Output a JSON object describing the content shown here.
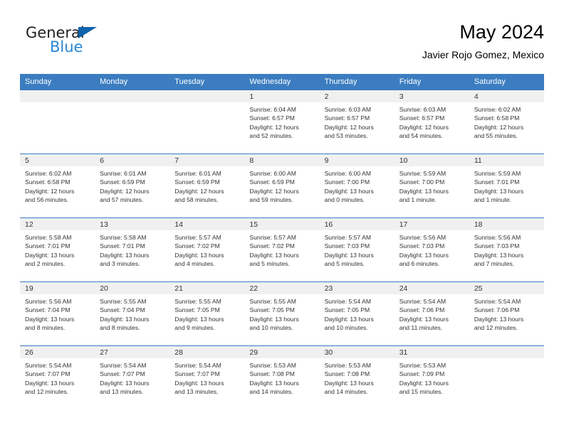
{
  "brand": {
    "general": "General",
    "blue": "Blue",
    "triangle_color": "#0d63ac",
    "blue_color": "#2787d6"
  },
  "header": {
    "title": "May 2024",
    "subtitle": "Javier Rojo Gomez, Mexico"
  },
  "theme": {
    "header_bg": "#3b7dc0",
    "day_band_bg": "#f0f0f0",
    "row_rule": "#3b7dc0",
    "text": "#333333"
  },
  "weekday_headers": [
    "Sunday",
    "Monday",
    "Tuesday",
    "Wednesday",
    "Thursday",
    "Friday",
    "Saturday"
  ],
  "weeks": [
    [
      {
        "day": "",
        "lines": []
      },
      {
        "day": "",
        "lines": []
      },
      {
        "day": "",
        "lines": []
      },
      {
        "day": "1",
        "lines": [
          "Sunrise: 6:04 AM",
          "Sunset: 6:57 PM",
          "Daylight: 12 hours",
          "and 52 minutes."
        ]
      },
      {
        "day": "2",
        "lines": [
          "Sunrise: 6:03 AM",
          "Sunset: 6:57 PM",
          "Daylight: 12 hours",
          "and 53 minutes."
        ]
      },
      {
        "day": "3",
        "lines": [
          "Sunrise: 6:03 AM",
          "Sunset: 6:57 PM",
          "Daylight: 12 hours",
          "and 54 minutes."
        ]
      },
      {
        "day": "4",
        "lines": [
          "Sunrise: 6:02 AM",
          "Sunset: 6:58 PM",
          "Daylight: 12 hours",
          "and 55 minutes."
        ]
      }
    ],
    [
      {
        "day": "5",
        "lines": [
          "Sunrise: 6:02 AM",
          "Sunset: 6:58 PM",
          "Daylight: 12 hours",
          "and 56 minutes."
        ]
      },
      {
        "day": "6",
        "lines": [
          "Sunrise: 6:01 AM",
          "Sunset: 6:59 PM",
          "Daylight: 12 hours",
          "and 57 minutes."
        ]
      },
      {
        "day": "7",
        "lines": [
          "Sunrise: 6:01 AM",
          "Sunset: 6:59 PM",
          "Daylight: 12 hours",
          "and 58 minutes."
        ]
      },
      {
        "day": "8",
        "lines": [
          "Sunrise: 6:00 AM",
          "Sunset: 6:59 PM",
          "Daylight: 12 hours",
          "and 59 minutes."
        ]
      },
      {
        "day": "9",
        "lines": [
          "Sunrise: 6:00 AM",
          "Sunset: 7:00 PM",
          "Daylight: 13 hours",
          "and 0 minutes."
        ]
      },
      {
        "day": "10",
        "lines": [
          "Sunrise: 5:59 AM",
          "Sunset: 7:00 PM",
          "Daylight: 13 hours",
          "and 1 minute."
        ]
      },
      {
        "day": "11",
        "lines": [
          "Sunrise: 5:59 AM",
          "Sunset: 7:01 PM",
          "Daylight: 13 hours",
          "and 1 minute."
        ]
      }
    ],
    [
      {
        "day": "12",
        "lines": [
          "Sunrise: 5:58 AM",
          "Sunset: 7:01 PM",
          "Daylight: 13 hours",
          "and 2 minutes."
        ]
      },
      {
        "day": "13",
        "lines": [
          "Sunrise: 5:58 AM",
          "Sunset: 7:01 PM",
          "Daylight: 13 hours",
          "and 3 minutes."
        ]
      },
      {
        "day": "14",
        "lines": [
          "Sunrise: 5:57 AM",
          "Sunset: 7:02 PM",
          "Daylight: 13 hours",
          "and 4 minutes."
        ]
      },
      {
        "day": "15",
        "lines": [
          "Sunrise: 5:57 AM",
          "Sunset: 7:02 PM",
          "Daylight: 13 hours",
          "and 5 minutes."
        ]
      },
      {
        "day": "16",
        "lines": [
          "Sunrise: 5:57 AM",
          "Sunset: 7:03 PM",
          "Daylight: 13 hours",
          "and 5 minutes."
        ]
      },
      {
        "day": "17",
        "lines": [
          "Sunrise: 5:56 AM",
          "Sunset: 7:03 PM",
          "Daylight: 13 hours",
          "and 6 minutes."
        ]
      },
      {
        "day": "18",
        "lines": [
          "Sunrise: 5:56 AM",
          "Sunset: 7:03 PM",
          "Daylight: 13 hours",
          "and 7 minutes."
        ]
      }
    ],
    [
      {
        "day": "19",
        "lines": [
          "Sunrise: 5:56 AM",
          "Sunset: 7:04 PM",
          "Daylight: 13 hours",
          "and 8 minutes."
        ]
      },
      {
        "day": "20",
        "lines": [
          "Sunrise: 5:55 AM",
          "Sunset: 7:04 PM",
          "Daylight: 13 hours",
          "and 8 minutes."
        ]
      },
      {
        "day": "21",
        "lines": [
          "Sunrise: 5:55 AM",
          "Sunset: 7:05 PM",
          "Daylight: 13 hours",
          "and 9 minutes."
        ]
      },
      {
        "day": "22",
        "lines": [
          "Sunrise: 5:55 AM",
          "Sunset: 7:05 PM",
          "Daylight: 13 hours",
          "and 10 minutes."
        ]
      },
      {
        "day": "23",
        "lines": [
          "Sunrise: 5:54 AM",
          "Sunset: 7:05 PM",
          "Daylight: 13 hours",
          "and 10 minutes."
        ]
      },
      {
        "day": "24",
        "lines": [
          "Sunrise: 5:54 AM",
          "Sunset: 7:06 PM",
          "Daylight: 13 hours",
          "and 11 minutes."
        ]
      },
      {
        "day": "25",
        "lines": [
          "Sunrise: 5:54 AM",
          "Sunset: 7:06 PM",
          "Daylight: 13 hours",
          "and 12 minutes."
        ]
      }
    ],
    [
      {
        "day": "26",
        "lines": [
          "Sunrise: 5:54 AM",
          "Sunset: 7:07 PM",
          "Daylight: 13 hours",
          "and 12 minutes."
        ]
      },
      {
        "day": "27",
        "lines": [
          "Sunrise: 5:54 AM",
          "Sunset: 7:07 PM",
          "Daylight: 13 hours",
          "and 13 minutes."
        ]
      },
      {
        "day": "28",
        "lines": [
          "Sunrise: 5:54 AM",
          "Sunset: 7:07 PM",
          "Daylight: 13 hours",
          "and 13 minutes."
        ]
      },
      {
        "day": "29",
        "lines": [
          "Sunrise: 5:53 AM",
          "Sunset: 7:08 PM",
          "Daylight: 13 hours",
          "and 14 minutes."
        ]
      },
      {
        "day": "30",
        "lines": [
          "Sunrise: 5:53 AM",
          "Sunset: 7:08 PM",
          "Daylight: 13 hours",
          "and 14 minutes."
        ]
      },
      {
        "day": "31",
        "lines": [
          "Sunrise: 5:53 AM",
          "Sunset: 7:09 PM",
          "Daylight: 13 hours",
          "and 15 minutes."
        ]
      },
      {
        "day": "",
        "lines": []
      }
    ]
  ]
}
